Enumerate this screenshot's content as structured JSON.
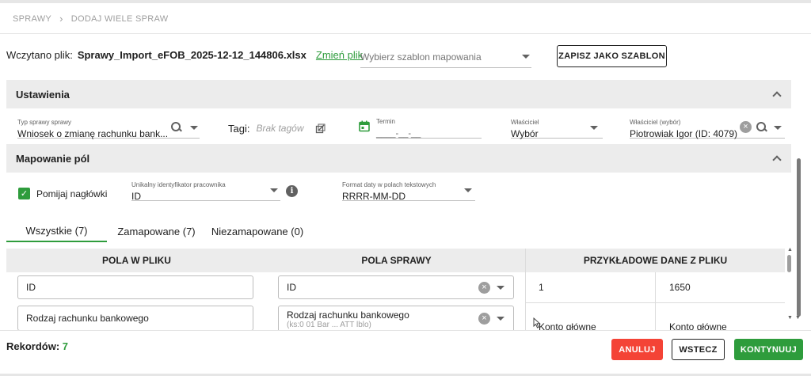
{
  "breadcrumb": {
    "root": "SPRAWY",
    "current": "DODAJ WIELE SPRAW"
  },
  "file": {
    "label": "Wczytano plik:",
    "name": "Sprawy_Import_eFOB_2025-12-12_144806.xlsx",
    "change_link": "Zmień plik"
  },
  "template": {
    "placeholder": "Wybierz szablon mapowania",
    "save_button": "ZAPISZ JAKO SZABLON"
  },
  "settings": {
    "title": "Ustawienia",
    "case_type": {
      "label": "Typ sprawy sprawy",
      "value": "Wniosek o zmianę rachunku bank..."
    },
    "tags": {
      "label": "Tagi:",
      "value": "Brak tagów"
    },
    "deadline": {
      "label": "Termin",
      "value": "____-__-__"
    },
    "owner": {
      "label": "Właściciel",
      "value": "Wybór"
    },
    "owner_choice": {
      "label": "Właściciel (wybór)",
      "value": "Piotrowiak Igor (ID: 4079)"
    }
  },
  "mapping": {
    "title": "Mapowanie pól",
    "skip_headers": {
      "label": "Pomijaj nagłówki",
      "checked": true
    },
    "unique_id": {
      "label": "Unikalny identyfikator pracownika",
      "value": "ID"
    },
    "date_format": {
      "label": "Format daty w polach tekstowych",
      "value": "RRRR-MM-DD"
    },
    "tabs": [
      {
        "label": "Wszystkie (7)",
        "active": true
      },
      {
        "label": "Zamapowane (7)",
        "active": false
      },
      {
        "label": "Niezamapowane (0)",
        "active": false
      }
    ]
  },
  "table": {
    "headers": [
      "POLA W PLIKU",
      "POLA SPRAWY",
      "PRZYKŁADOWE DANE Z PLIKU"
    ],
    "rows": [
      {
        "file_field": "ID",
        "case_field": "ID",
        "case_sub": "",
        "sample1": "1",
        "sample2": "1650"
      },
      {
        "file_field": "Rodzaj rachunku bankowego",
        "case_field": "Rodzaj rachunku bankowego",
        "case_sub": "(ks:0 01 Bar ... ATT lblo)",
        "sample1": "Konto główne",
        "sample2": "Konto główne"
      }
    ]
  },
  "footer": {
    "records_label": "Rekordów:",
    "records_count": "7",
    "cancel": "ANULUJ",
    "back": "WSTECZ",
    "continue": "KONTYNUUJ"
  },
  "colors": {
    "accent": "#2e9c3c",
    "danger": "#f44336",
    "panel": "#ececec"
  }
}
